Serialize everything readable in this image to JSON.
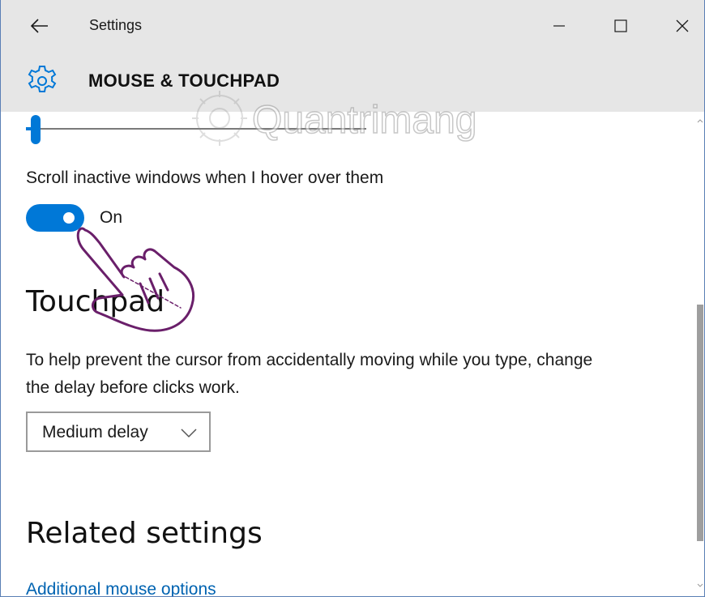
{
  "window": {
    "title": "Settings",
    "icons": {
      "back": "back-arrow-icon",
      "minimize": "minimize-icon",
      "maximize": "maximize-icon",
      "close": "close-icon",
      "header": "gear-icon"
    }
  },
  "header": {
    "title": "MOUSE & TOUCHPAD"
  },
  "scroll_settings": {
    "scroll_inactive_label": "Scroll inactive windows when I hover over them",
    "toggle_state": "On",
    "toggle_on": true
  },
  "touchpad": {
    "title": "Touchpad",
    "description": "To help prevent the cursor from accidentally moving while you type, change the delay before clicks work.",
    "delay_selected": "Medium delay"
  },
  "related": {
    "title": "Related settings",
    "link": "Additional mouse options"
  },
  "watermark": {
    "text": "Quantrimang"
  },
  "colors": {
    "accent": "#0078d7",
    "link": "#0063b1",
    "chrome": "#e6e6e6",
    "annotation": "#6a1f6a"
  }
}
